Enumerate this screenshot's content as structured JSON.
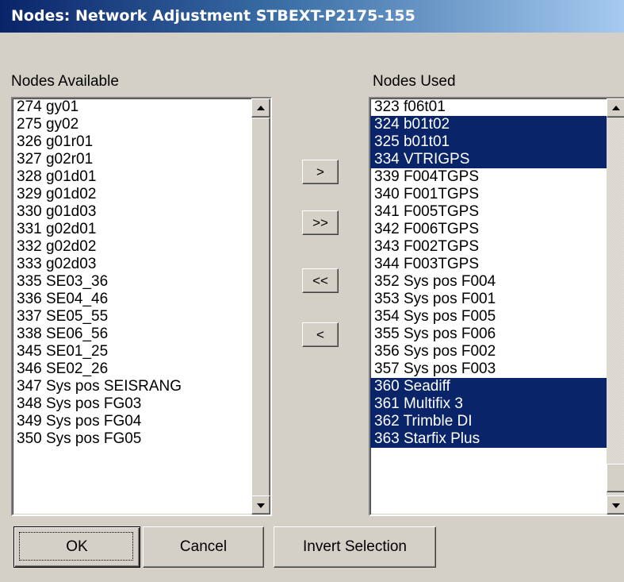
{
  "window": {
    "title": "Nodes: Network Adjustment STBEXT-P2175-155"
  },
  "available": {
    "label": "Nodes Available",
    "items": [
      "274 gy01",
      "275 gy02",
      "326 g01r01",
      "327 g02r01",
      "328 g01d01",
      "329 g01d02",
      "330 g01d03",
      "331 g02d01",
      "332 g02d02",
      "333 g02d03",
      "335 SE03_36",
      "336 SE04_46",
      "337 SE05_55",
      "338 SE06_56",
      "345 SE01_25",
      "346 SE02_26",
      "347 Sys pos SEISRANG",
      "348 Sys pos FG03",
      "349 Sys pos FG04",
      "350 Sys pos FG05"
    ]
  },
  "used": {
    "label": "Nodes Used",
    "items": [
      "323 f06t01",
      "324 b01t02",
      "325 b01t01",
      "334 VTRIGPS",
      "339 F004TGPS",
      "340 F001TGPS",
      "341 F005TGPS",
      "342 F006TGPS",
      "343 F002TGPS",
      "344 F003TGPS",
      "352 Sys pos F004",
      "353 Sys pos F001",
      "354 Sys pos F005",
      "355 Sys pos F006",
      "356 Sys pos F002",
      "357 Sys pos F003",
      "360 Seadiff",
      "361 Multifix 3",
      "362 Trimble DI",
      "363 Starfix Plus"
    ],
    "selected": [
      1,
      2,
      3,
      16,
      17,
      18,
      19
    ]
  },
  "move_buttons": {
    "add": ">",
    "add_all": ">>",
    "remove_all": "<<",
    "remove": "<"
  },
  "footer": {
    "ok": "OK",
    "cancel": "Cancel",
    "invert": "Invert Selection"
  },
  "colors": {
    "selection": "#0a246a",
    "face": "#d4d0c8"
  }
}
